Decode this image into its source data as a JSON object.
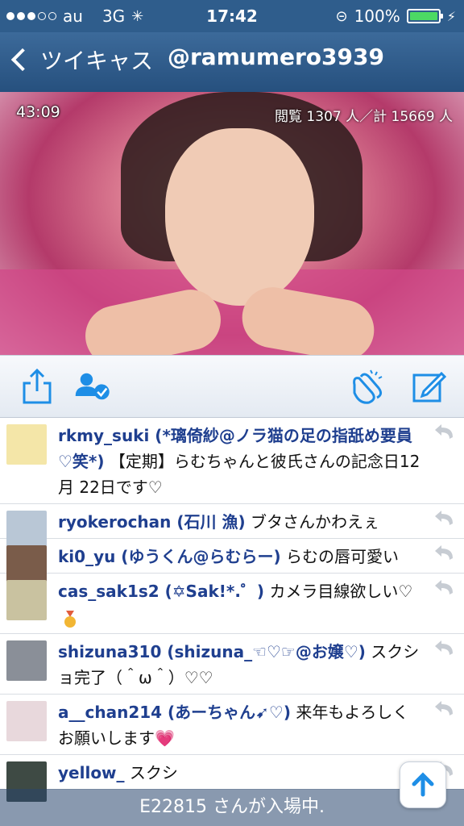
{
  "status_bar": {
    "carrier": "au",
    "network": "3G",
    "time": "17:42",
    "battery_percent": "100%",
    "battery_level": 1.0,
    "signal_bars_filled": 3,
    "signal_bars_total": 5
  },
  "nav": {
    "back_label": "ツイキャス",
    "title": "@ramumero3939"
  },
  "video": {
    "elapsed": "43:09",
    "viewers": "閲覧 1307 人／計 15669 人"
  },
  "toolbar": {
    "icons": [
      "share-icon",
      "follow-user-icon",
      "clap-icon",
      "compose-icon"
    ],
    "accent_color": "#1e8ee6"
  },
  "comments": [
    {
      "user": "rkmy_suki (*璃倚紗@ノラ猫の足の指舐め要員♡笑*)",
      "text": "【定期】らむちゃんと彼氏さんの記念日12月 22日です♡",
      "avatar_color": "#f4e6a8"
    },
    {
      "user": "ryokerochan (石川 漁)",
      "text": "ブタさんかわえぇ",
      "avatar_color": "#b9c7d6"
    },
    {
      "user": "ki0_yu (ゆうくん@らむらー)",
      "text": "らむの唇可愛い",
      "avatar_color": "#7a5c4a"
    },
    {
      "user": "cas_sak1s2 (✡Sak!*.゜)",
      "text": "カメラ目線欲しい♡",
      "avatar_color": "#c9c2a0"
    },
    {
      "user": "shizuna310 (shizuna_☜♡☞@お嬢♡)",
      "text": "スクショ完了（＾ω＾）♡♡",
      "avatar_color": "#8a8f98"
    },
    {
      "user": "a__chan214 (あーちゃん➹♡)",
      "text": "来年もよろしくお願いします💗",
      "avatar_color": "#e8d8dc"
    },
    {
      "user": "yellow_",
      "text": "スクシ",
      "avatar_color": "#3e4a44"
    }
  ],
  "toast": {
    "text": "E22815 さんが入場中."
  }
}
